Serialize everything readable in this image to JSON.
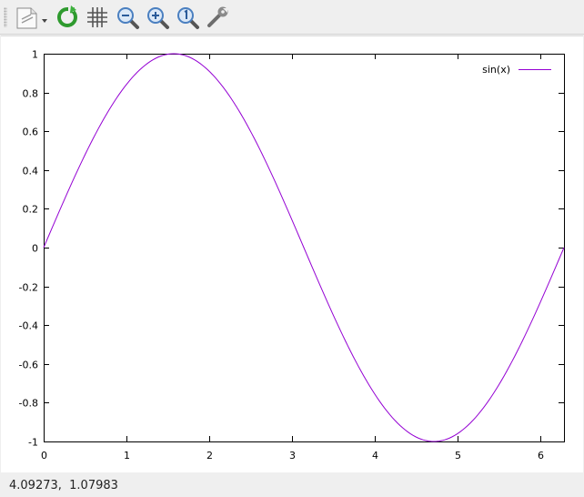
{
  "toolbar": {
    "buttons": [
      {
        "name": "export-button",
        "icon": "export-document-icon"
      },
      {
        "name": "replot-button",
        "icon": "replot-icon"
      },
      {
        "name": "grid-button",
        "icon": "grid-icon"
      },
      {
        "name": "zoom-out-button",
        "icon": "zoom-out-icon"
      },
      {
        "name": "zoom-in-button",
        "icon": "zoom-in-icon"
      },
      {
        "name": "zoom-reset-button",
        "icon": "zoom-reset-icon"
      },
      {
        "name": "settings-button",
        "icon": "wrench-icon"
      }
    ]
  },
  "status": {
    "coordinates": "4.09273,  1.07983"
  },
  "colors": {
    "series": "#9400d3",
    "replot_icon": "#2e9a2e",
    "zoom_icon": "#4a7fc0"
  },
  "chart_data": {
    "type": "line",
    "function": "sin(x)",
    "xlim": [
      0,
      6.283185
    ],
    "ylim": [
      -1,
      1
    ],
    "xticks": [
      0,
      1,
      2,
      3,
      4,
      5,
      6
    ],
    "xtick_labels": [
      "0",
      "1",
      "2",
      "3",
      "4",
      "5",
      "6"
    ],
    "yticks": [
      1,
      0.8,
      0.6,
      0.4,
      0.2,
      0,
      -0.2,
      -0.4,
      -0.6,
      -0.8,
      -1
    ],
    "ytick_labels": [
      "1",
      "0.8",
      "0.6",
      "0.4",
      "0.2",
      "0",
      "-0.2",
      "-0.4",
      "-0.6",
      "-0.8",
      "-1"
    ],
    "grid": false,
    "legend_position": "top-right",
    "series": [
      {
        "name": "sin(x)",
        "color": "#9400d3",
        "samples": 200
      }
    ]
  }
}
